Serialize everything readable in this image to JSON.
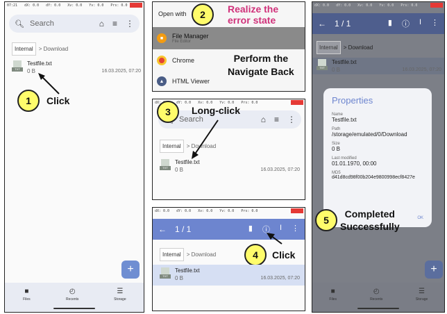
{
  "panel1": {
    "status_left": "07:21",
    "status_items": [
      "dX: 0.0",
      "dY: 0.0",
      "Xv: 0.0",
      "Yv: 0.0",
      "Prs: 0.0"
    ],
    "search_placeholder": "Search",
    "breadcrumb_root": "Internal",
    "breadcrumb_path": "> Download",
    "file_name": "Testfile.txt",
    "file_size": "0 B",
    "file_date": "16.03.2025, 07:20",
    "file_type": "TXT",
    "annotation_num": "1",
    "annotation_text": "Click",
    "fab": "+",
    "nav": [
      "Files",
      "Recents",
      "Storage"
    ]
  },
  "panel2": {
    "title": "Open with",
    "callout_num": "2",
    "callout_text_line1": "Realize the",
    "callout_text_line2": "error state",
    "items": [
      {
        "label": "File Manager",
        "sub": "File Editor"
      },
      {
        "label": "Chrome",
        "sub": ""
      },
      {
        "label": "HTML Viewer",
        "sub": ""
      }
    ],
    "annotation_line1": "Perform the",
    "annotation_line2": "Navigate Back"
  },
  "panel3": {
    "status_items": [
      "dX: 0.0",
      "dY: 0.0",
      "Xv: 0.0",
      "Yv: 0.0",
      "Prs: 0.0"
    ],
    "search_placeholder": "Search",
    "callout_num": "3",
    "annotation_text": "Long-click",
    "breadcrumb_root": "Internal",
    "breadcrumb_path": "> Download",
    "file_name": "Testfile.txt",
    "file_size": "0 B",
    "file_date": "16.03.2025, 07:20",
    "file_type": "TXT"
  },
  "panel4": {
    "status_items": [
      "dX: 0.0",
      "dY: 0.0",
      "Xv: 0.0",
      "Yv: 0.0",
      "Prs: 0.0"
    ],
    "selection_count": "1 / 1",
    "callout_num": "4",
    "annotation_text": "Click",
    "breadcrumb_root": "Internal",
    "breadcrumb_path": "> Download",
    "file_name": "Testfile.txt",
    "file_size": "0 B",
    "file_date": "16.03.2025, 07:20",
    "file_type": "TXT"
  },
  "panel5": {
    "status_items": [
      "dX: 0.0",
      "dY: 0.0",
      "Xv: 0.0",
      "Yv: 0.0",
      "Prs: 0.0"
    ],
    "selection_count": "1 / 1",
    "breadcrumb_root": "Internal",
    "breadcrumb_path": "> Download",
    "file_name": "Testfile.txt",
    "file_size": "0 B",
    "file_date": "16.03.2025, 07:20",
    "file_type": "TXT",
    "dialog": {
      "title": "Properties",
      "name_label": "Name",
      "name_value": "Testfile.txt",
      "path_label": "Path",
      "path_value": "/storage/emulated/0/Download",
      "size_label": "Size",
      "size_value": "0 B",
      "modified_label": "Last modified",
      "modified_value": "01.01.1970, 00:00",
      "md5_label": "MD5",
      "md5_value": "d41d8cd98f00b204e9800998ecf8427e",
      "ok": "OK"
    },
    "callout_num": "5",
    "annotation_line1": "Completed",
    "annotation_line2": "Successfully",
    "fab": "+",
    "nav": [
      "Files",
      "Recents",
      "Storage"
    ]
  },
  "colors": {
    "accent": "#6d85cf",
    "callout": "#fffc6b",
    "hint": "#d0317a"
  }
}
